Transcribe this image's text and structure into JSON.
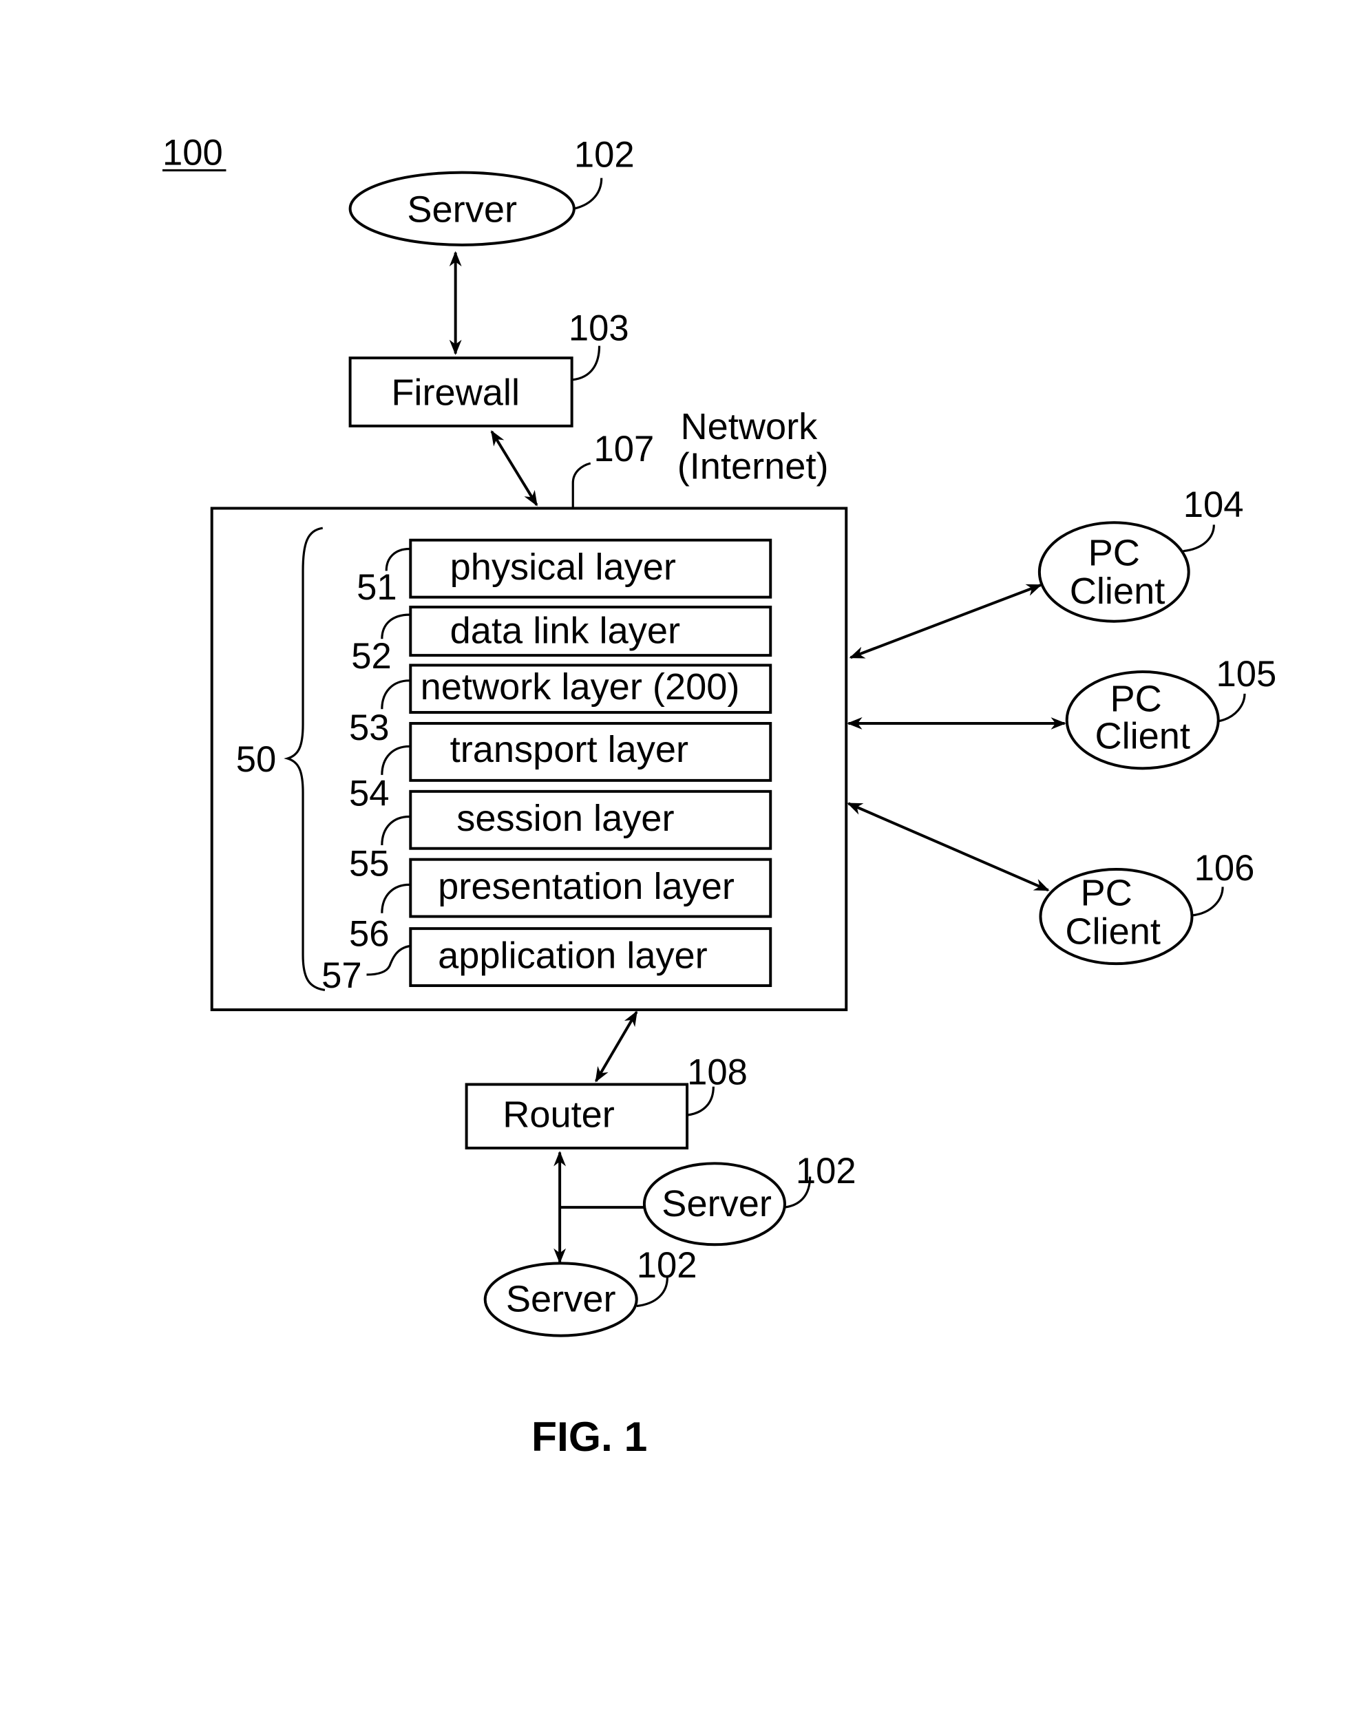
{
  "figure": {
    "ref_number": "100",
    "caption": "FIG. 1"
  },
  "top_server": {
    "label": "Server",
    "ref": "102"
  },
  "firewall": {
    "label": "Firewall",
    "ref": "103"
  },
  "network": {
    "label_line1": "Network",
    "label_line2": "(Internet)",
    "ref": "107"
  },
  "layer_stack": {
    "ref": "50",
    "layers": [
      {
        "ref": "51",
        "label": "physical layer"
      },
      {
        "ref": "52",
        "label": "data link layer"
      },
      {
        "ref": "53",
        "label": "network layer (200)"
      },
      {
        "ref": "54",
        "label": "transport layer"
      },
      {
        "ref": "55",
        "label": "session layer"
      },
      {
        "ref": "56",
        "label": "presentation layer"
      },
      {
        "ref": "57",
        "label": "application layer"
      }
    ]
  },
  "clients": [
    {
      "line1": "PC",
      "line2": "Client",
      "ref": "104"
    },
    {
      "line1": "PC",
      "line2": "Client",
      "ref": "105"
    },
    {
      "line1": "PC",
      "line2": "Client",
      "ref": "106"
    }
  ],
  "router": {
    "label": "Router",
    "ref": "108"
  },
  "bottom_servers": [
    {
      "label": "Server",
      "ref": "102"
    },
    {
      "label": "Server",
      "ref": "102"
    }
  ]
}
